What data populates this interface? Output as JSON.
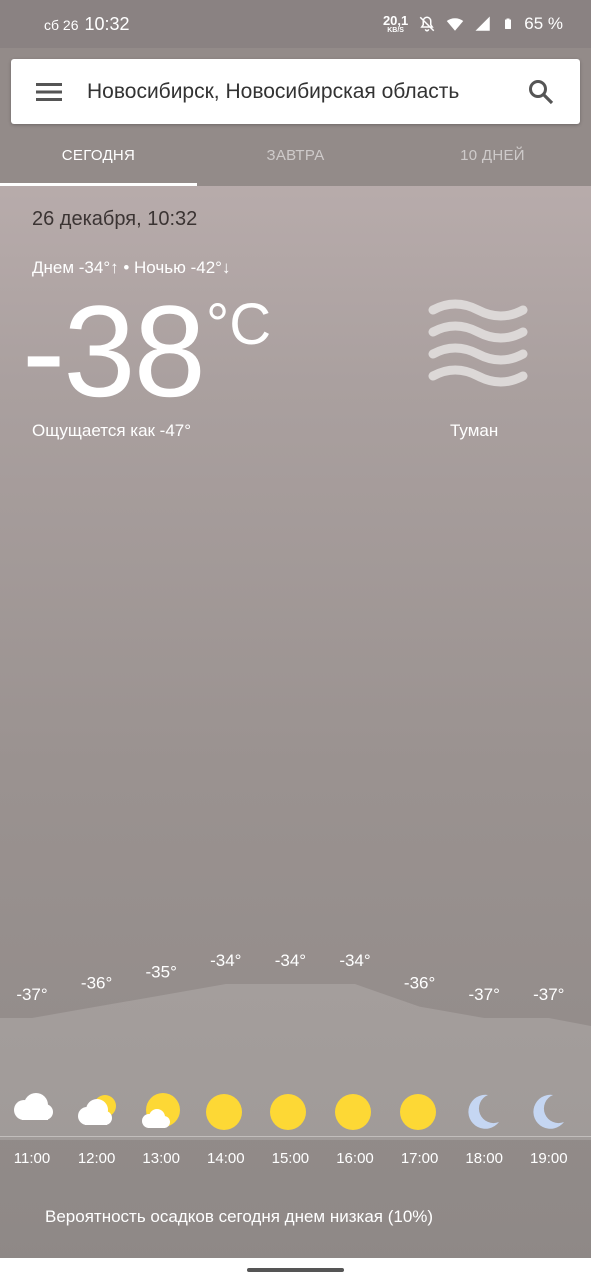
{
  "status": {
    "day": "сб 26",
    "time": "10:32",
    "netspeed_value": "20,1",
    "netspeed_unit": "KB/S",
    "battery": "65 %"
  },
  "search": {
    "location": "Новосибирск, Новосибирская область"
  },
  "tabs": [
    "СЕГОДНЯ",
    "ЗАВТРА",
    "10 ДНЕЙ"
  ],
  "current": {
    "date": "26 декабря, 10:32",
    "day_night": "Днем -34°↑ • Ночью -42°↓",
    "temperature": "-38",
    "unit": "°C",
    "feels_like": "Ощущается как -47°",
    "condition": "Туман",
    "condition_icon": "fog-icon"
  },
  "hourly": [
    {
      "time": "11:00",
      "temp": "-37°",
      "value": -37,
      "icon": "cloudy-icon"
    },
    {
      "time": "12:00",
      "temp": "-36°",
      "value": -36,
      "icon": "partly-cloudy-icon"
    },
    {
      "time": "13:00",
      "temp": "-35°",
      "value": -35,
      "icon": "mostly-sunny-icon"
    },
    {
      "time": "14:00",
      "temp": "-34°",
      "value": -34,
      "icon": "sun-icon"
    },
    {
      "time": "15:00",
      "temp": "-34°",
      "value": -34,
      "icon": "sun-icon"
    },
    {
      "time": "16:00",
      "temp": "-34°",
      "value": -34,
      "icon": "sun-icon"
    },
    {
      "time": "17:00",
      "temp": "-36°",
      "value": -36,
      "icon": "sun-icon"
    },
    {
      "time": "18:00",
      "temp": "-37°",
      "value": -37,
      "icon": "moon-icon"
    },
    {
      "time": "19:00",
      "temp": "-37°",
      "value": -37,
      "icon": "moon-icon"
    }
  ],
  "precip_text": "Вероятность осадков сегодня днем низкая (10%)",
  "colors": {
    "sun": "#fdd835",
    "moon": "#c5d6f2",
    "cloud": "#ffffff"
  }
}
